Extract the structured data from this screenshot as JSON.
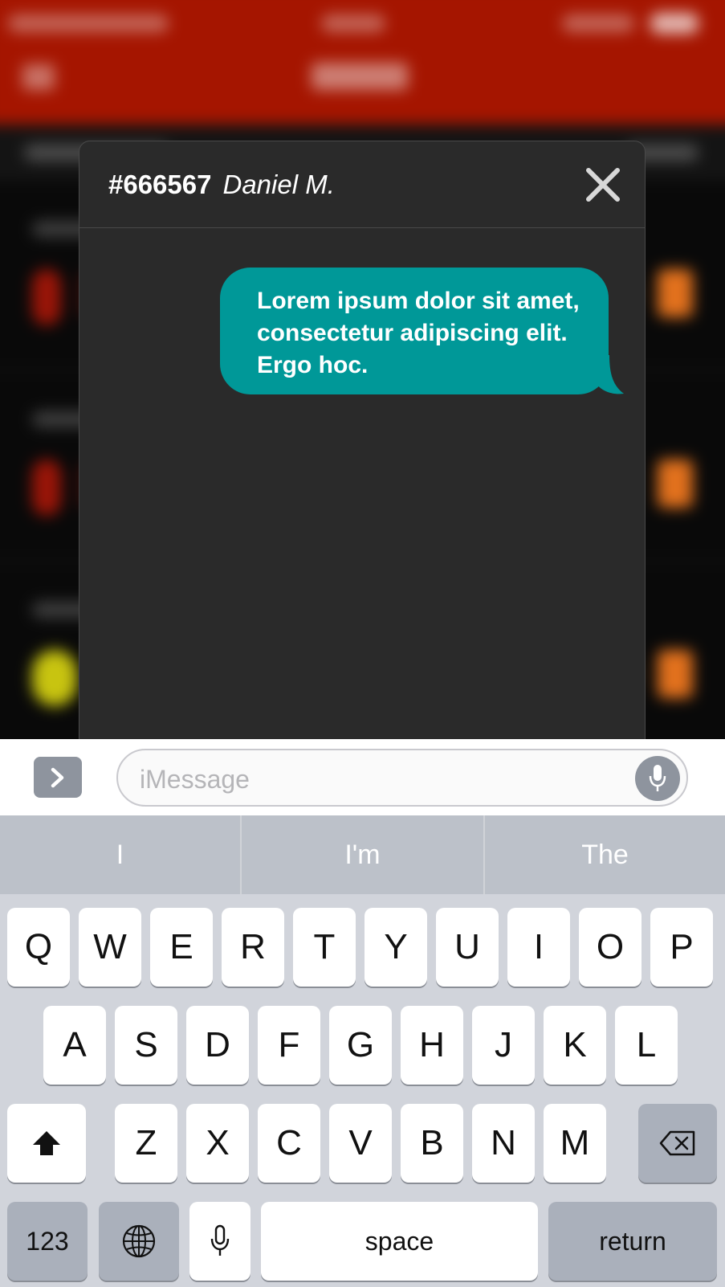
{
  "modal": {
    "order_number": "#666567",
    "customer_name": "Daniel M.",
    "close_icon": "close-icon"
  },
  "messages": [
    {
      "text": "Lorem ipsum dolor sit amet, consectetur adipiscing elit. Ergo hoc.",
      "color": "#009898",
      "side": "right"
    }
  ],
  "input": {
    "placeholder": "iMessage"
  },
  "suggestions": [
    "I",
    "I'm",
    "The"
  ],
  "keyboard": {
    "row1": [
      "Q",
      "W",
      "E",
      "R",
      "T",
      "Y",
      "U",
      "I",
      "O",
      "P"
    ],
    "row2": [
      "A",
      "S",
      "D",
      "F",
      "G",
      "H",
      "J",
      "K",
      "L"
    ],
    "row3": [
      "Z",
      "X",
      "C",
      "V",
      "B",
      "N",
      "M"
    ],
    "numbers_key": "123",
    "space_key": "space",
    "return_key": "return"
  },
  "colors": {
    "header_red": "#a51500",
    "bubble_teal": "#009898",
    "keyboard_bg": "#d1d4db"
  }
}
